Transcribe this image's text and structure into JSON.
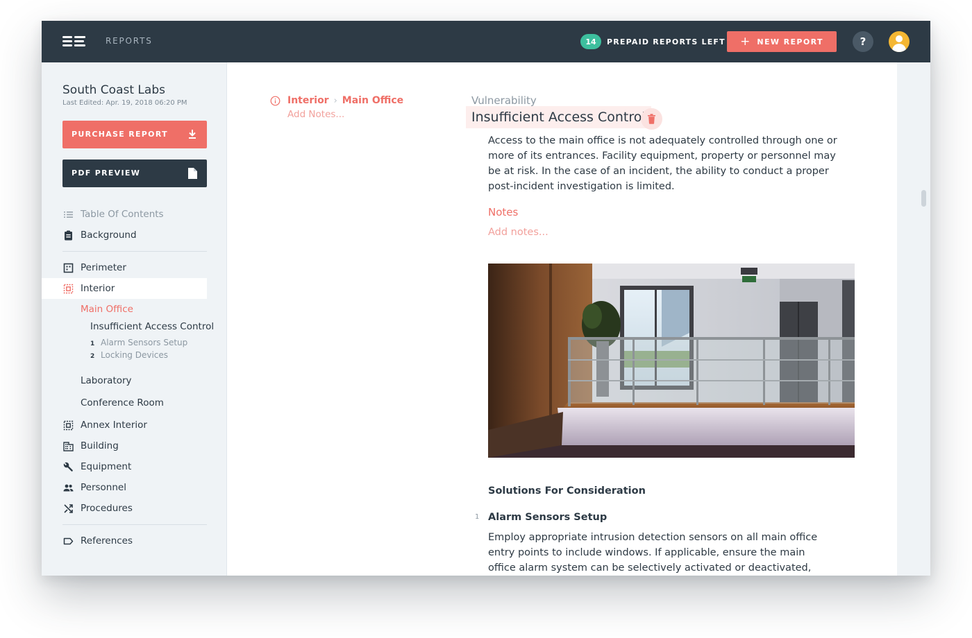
{
  "header": {
    "app_section": "REPORTS",
    "prepaid_count": "14",
    "prepaid_label": "PREPAID REPORTS LEFT",
    "new_report_label": "NEW REPORT",
    "help_label": "?"
  },
  "sidebar": {
    "project_name": "South Coast Labs",
    "last_edited": "Last Edited: Apr. 19, 2018 06:20 PM",
    "purchase_label": "PURCHASE REPORT",
    "pdf_label": "PDF PREVIEW",
    "items": {
      "toc": "Table Of Contents",
      "background": "Background",
      "perimeter": "Perimeter",
      "interior": "Interior",
      "main_office": "Main Office",
      "vulnerability": "Insufficient Access Control",
      "solution_1_num": "1",
      "solution_1": "Alarm Sensors Setup",
      "solution_2_num": "2",
      "solution_2": "Locking Devices",
      "laboratory": "Laboratory",
      "conference_room": "Conference Room",
      "annex_interior": "Annex Interior",
      "building": "Building",
      "equipment": "Equipment",
      "personnel": "Personnel",
      "procedures": "Procedures",
      "references": "References"
    }
  },
  "main": {
    "breadcrumb": [
      "Interior",
      "Main Office"
    ],
    "breadcrumb_add_notes": "Add Notes...",
    "vulnerability_label": "Vulnerability",
    "vulnerability_title": "Insufficient Access Control",
    "description": "Access to the main office is not adequately controlled through one or more of its entrances. Facility equipment, property or personnel may be at risk. In the case of an incident, the ability to conduct a proper post-incident investigation is limited.",
    "notes_heading": "Notes",
    "notes_placeholder": "Add notes...",
    "solutions_heading": "Solutions For Consideration",
    "solution_number": "1",
    "solution_title": "Alarm Sensors Setup",
    "solution_text": "Employ appropriate intrusion detection sensors on all main office entry points to include windows. If applicable, ensure the main office alarm system can be selectively activated or deactivated, separate"
  },
  "colors": {
    "topbar": "#2d3a45",
    "accent": "#ef6f67",
    "badge": "#3dbf9e",
    "sidebar_bg": "#eff3f6",
    "avatar": "#f5b733"
  }
}
